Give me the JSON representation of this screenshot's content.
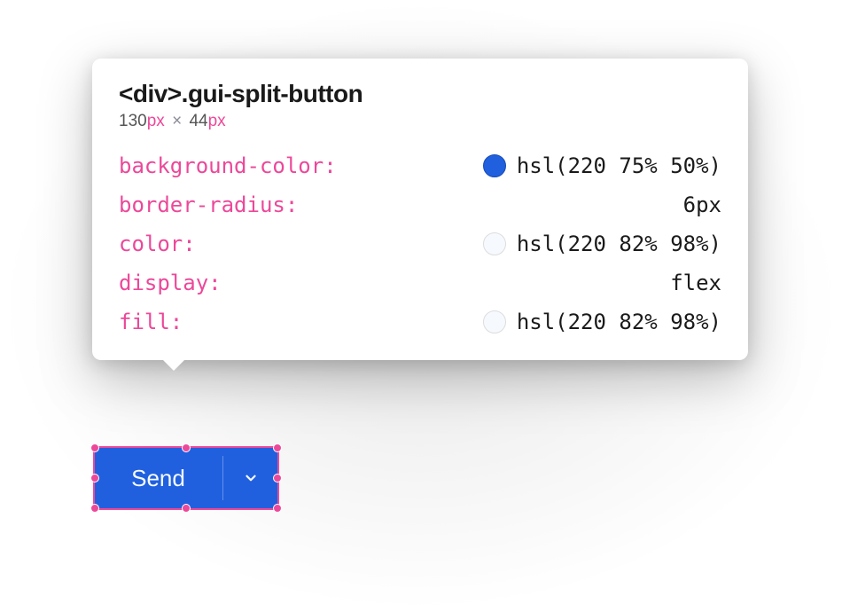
{
  "inspector": {
    "element_tag": "<div>",
    "element_class": ".gui-split-button",
    "width_value": "130",
    "width_unit": "px",
    "times": "×",
    "height_value": "44",
    "height_unit": "px",
    "properties": [
      {
        "name": "background-color",
        "colon": ":",
        "value": "hsl(220 75% 50%)",
        "swatch": "blue"
      },
      {
        "name": "border-radius",
        "colon": ":",
        "value": "6px",
        "swatch": null
      },
      {
        "name": "color",
        "colon": ":",
        "value": "hsl(220 82% 98%)",
        "swatch": "white"
      },
      {
        "name": "display",
        "colon": ":",
        "value": "flex",
        "swatch": null
      },
      {
        "name": "fill",
        "colon": ":",
        "value": "hsl(220 82% 98%)",
        "swatch": "white"
      }
    ]
  },
  "button": {
    "label": "Send"
  },
  "colors": {
    "accent_pink": "#ec4899",
    "button_bg": "hsl(220 75% 50%)",
    "button_text": "hsl(220 82% 98%)"
  }
}
